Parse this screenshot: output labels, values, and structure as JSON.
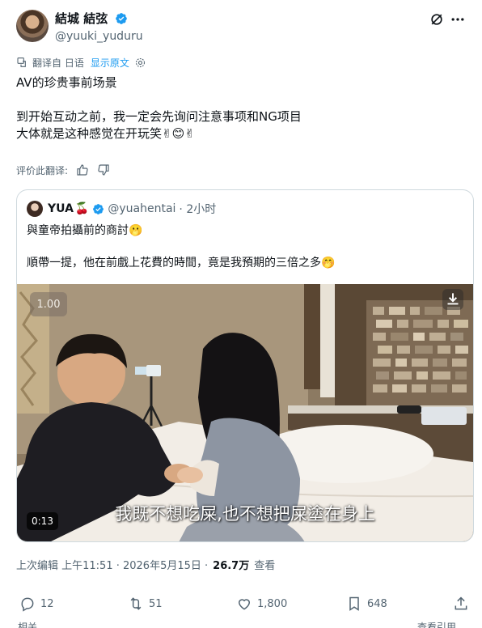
{
  "author": {
    "display_name": "結城 結弦",
    "handle": "@yuuki_yuduru"
  },
  "translate_bar": {
    "translated_from": "翻译自 日语",
    "show_original": "显示原文"
  },
  "tweet": {
    "line1": "AV的珍贵事前场景",
    "line2": "到开始互动之前，我一定会先询问注意事项和NG项目",
    "line3": "大体就是这种感觉在开玩笑",
    "line3_emojis": "✌😊✌"
  },
  "rate_translation": "评价此翻译:",
  "quote": {
    "display_name": "YUA",
    "name_emoji": "🍒",
    "handle": "@yuahentai",
    "time": "· 2小时",
    "line1": "與童帝拍攝前的商討",
    "line1_emoji": "🫢",
    "line2": "順帶一提，他在前戲上花費的時間，竟是我預期的三倍之多",
    "line2_emoji": "🤭",
    "video": {
      "speed": "1.00",
      "timestamp": "0:13",
      "subtitle": "我既不想吃屎,也不想把屎塗在身上"
    }
  },
  "meta": {
    "edited": "上次编辑 上午11:51 · 2026年5月15日 ·",
    "views": "26.7万",
    "views_label": "查看"
  },
  "actions": {
    "replies": "12",
    "reposts": "51",
    "likes": "1,800",
    "bookmarks": "648"
  },
  "bottom_cut": {
    "left": "相关",
    "right": "查看引用"
  },
  "colors": {
    "accent": "#1d9bf0",
    "secondary_text": "#536471",
    "border": "#cfd9de"
  }
}
